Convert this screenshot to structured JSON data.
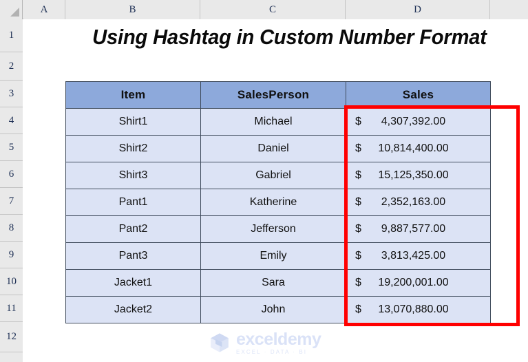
{
  "app": {
    "type": "spreadsheet"
  },
  "grid": {
    "column_headers": [
      "A",
      "B",
      "C",
      "D"
    ],
    "row_headers": [
      "1",
      "2",
      "3",
      "4",
      "5",
      "6",
      "7",
      "8",
      "9",
      "10",
      "11",
      "12"
    ],
    "corner_icon": "select-all-triangle-icon"
  },
  "title": {
    "text": "Using Hashtag in Custom Number Format"
  },
  "table": {
    "headers": [
      "Item",
      "SalesPerson",
      "Sales"
    ],
    "rows": [
      {
        "item": "Shirt1",
        "person": "Michael",
        "currency": "$",
        "sales": "4,307,392.00"
      },
      {
        "item": "Shirt2",
        "person": "Daniel",
        "currency": "$",
        "sales": "10,814,400.00"
      },
      {
        "item": "Shirt3",
        "person": "Gabriel",
        "currency": "$",
        "sales": "15,125,350.00"
      },
      {
        "item": "Pant1",
        "person": "Katherine",
        "currency": "$",
        "sales": "2,352,163.00"
      },
      {
        "item": "Pant2",
        "person": "Jefferson",
        "currency": "$",
        "sales": "9,887,577.00"
      },
      {
        "item": "Pant3",
        "person": "Emily",
        "currency": "$",
        "sales": "3,813,425.00"
      },
      {
        "item": "Jacket1",
        "person": "Sara",
        "currency": "$",
        "sales": "19,200,001.00"
      },
      {
        "item": "Jacket2",
        "person": "John",
        "currency": "$",
        "sales": "13,070,880.00"
      }
    ]
  },
  "annotation": {
    "highlight_color": "#FF0000",
    "target_column": "Sales"
  },
  "watermark": {
    "name": "exceldemy",
    "tagline": "EXCEL · DATA · BI"
  },
  "colors": {
    "header_fill": "#8DA9DB",
    "cell_fill": "#DCE3F5",
    "grid_border": "#3f4b5c",
    "sheet_chrome": "#e9e9e9",
    "highlight": "#FF0000"
  }
}
